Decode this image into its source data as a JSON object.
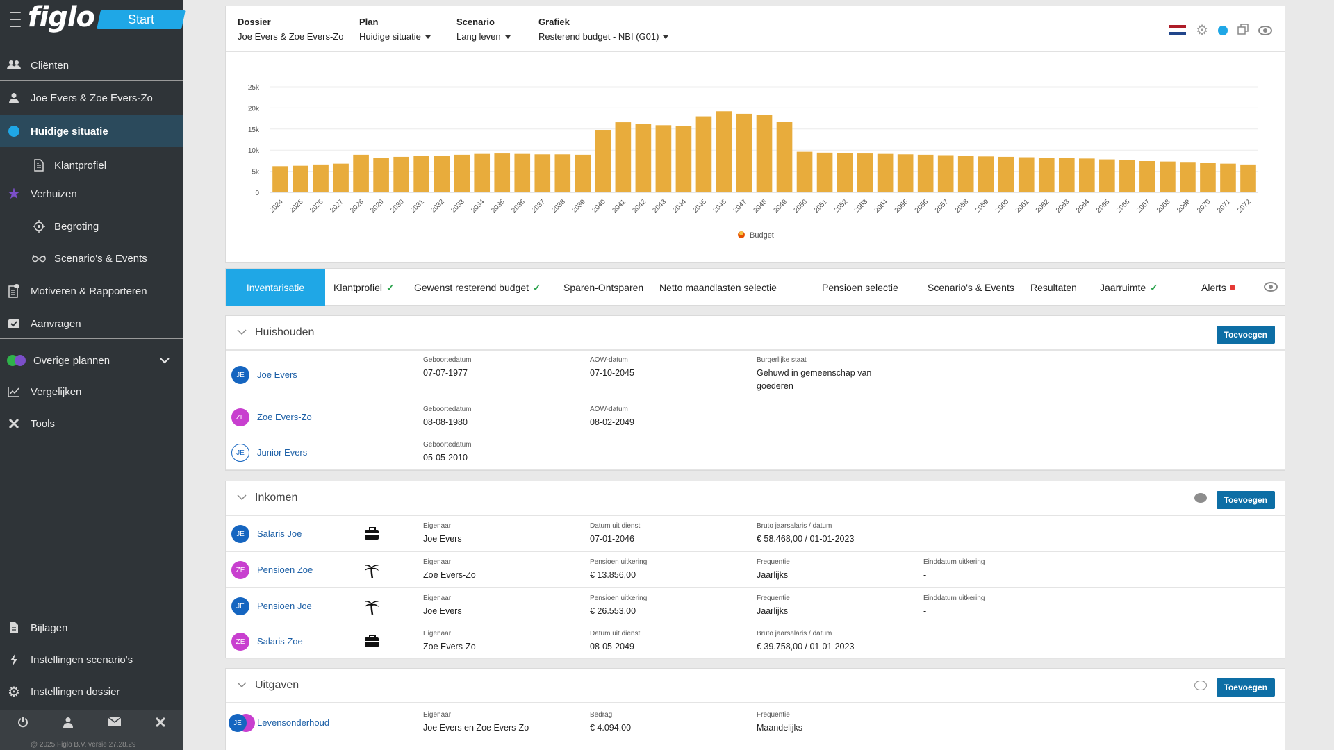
{
  "sidebar": {
    "logo": "figlo",
    "start_label": "Start",
    "items": [
      {
        "label": "Cliënten",
        "icon": "users-icon"
      },
      {
        "label": "Joe Evers & Zoe Evers-Zo",
        "icon": "user-icon"
      },
      {
        "label": "Huidige situatie",
        "icon": "blue-dot-icon"
      },
      {
        "label": "Klantprofiel",
        "icon": "document-icon"
      },
      {
        "label": "Verhuizen",
        "icon": "star-icon"
      },
      {
        "label": "Begroting",
        "icon": "crosshair-icon"
      },
      {
        "label": "Scenario's & Events",
        "icon": "glasses-icon"
      },
      {
        "label": "Motiveren & Rapporteren",
        "icon": "report-icon"
      },
      {
        "label": "Aanvragen",
        "icon": "request-icon"
      },
      {
        "label": "Overige plannen",
        "icon": "plans-icon"
      },
      {
        "label": "Vergelijken",
        "icon": "chart-line-icon"
      },
      {
        "label": "Tools",
        "icon": "tools-icon"
      },
      {
        "label": "Bijlagen",
        "icon": "attachment-icon"
      },
      {
        "label": "Instellingen scenario's",
        "icon": "bolt-icon"
      },
      {
        "label": "Instellingen dossier",
        "icon": "gear-icon"
      }
    ],
    "version": "@ 2025 Figlo B.V. versie 27.28.29"
  },
  "header": {
    "dossier_label": "Dossier",
    "dossier_value": "Joe Evers & Zoe Evers-Zo",
    "plan_label": "Plan",
    "plan_value": "Huidige situatie",
    "scenario_label": "Scenario",
    "scenario_value": "Lang leven",
    "grafiek_label": "Grafiek",
    "grafiek_value": "Resterend budget - NBI (G01)"
  },
  "colors": {
    "accent": "#1fa7e6",
    "bar": "#e8ac3c",
    "sidebar_bg": "#2f3438",
    "button": "#0d6ea5"
  },
  "chart_data": {
    "type": "bar",
    "categories": [
      "2024",
      "2025",
      "2026",
      "2027",
      "2028",
      "2029",
      "2030",
      "2031",
      "2032",
      "2033",
      "2034",
      "2035",
      "2036",
      "2037",
      "2038",
      "2039",
      "2040",
      "2041",
      "2042",
      "2043",
      "2044",
      "2045",
      "2046",
      "2047",
      "2048",
      "2049",
      "2050",
      "2051",
      "2052",
      "2053",
      "2054",
      "2055",
      "2056",
      "2057",
      "2058",
      "2059",
      "2060",
      "2061",
      "2062",
      "2063",
      "2064",
      "2065",
      "2066",
      "2067",
      "2068",
      "2069",
      "2070",
      "2071",
      "2072"
    ],
    "series": [
      {
        "name": "Budget",
        "values": [
          6200,
          6300,
          6600,
          6800,
          8900,
          8200,
          8400,
          8600,
          8700,
          8900,
          9100,
          9200,
          9100,
          9000,
          9000,
          8900,
          14800,
          16600,
          16200,
          15900,
          15700,
          18000,
          19200,
          18600,
          18400,
          16700,
          9600,
          9400,
          9300,
          9200,
          9100,
          9000,
          8900,
          8800,
          8600,
          8500,
          8400,
          8300,
          8200,
          8100,
          8000,
          7800,
          7600,
          7400,
          7300,
          7200,
          7000,
          6800,
          6600
        ]
      }
    ],
    "yticks": [
      "0",
      "5k",
      "10k",
      "15k",
      "20k",
      "25k"
    ],
    "ylim": [
      0,
      25000
    ],
    "legend": "bottom",
    "grid": true
  },
  "tabs": [
    {
      "label": "Inventarisatie",
      "check": false
    },
    {
      "label": "Klantprofiel",
      "check": true
    },
    {
      "label": "Gewenst resterend budget",
      "check": true
    },
    {
      "label": "Sparen-Ontsparen",
      "check": false
    },
    {
      "label": "Netto maandlasten selectie",
      "check": false
    },
    {
      "label": "Pensioen selectie",
      "check": false
    },
    {
      "label": "Scenario's & Events",
      "check": false
    },
    {
      "label": "Resultaten",
      "check": false
    },
    {
      "label": "Jaarruimte",
      "check": true
    },
    {
      "label": "Alerts",
      "check": false
    }
  ],
  "check_mark": "✓",
  "add_label": "Toevoegen",
  "huishouden": {
    "title": "Huishouden",
    "rows": [
      {
        "initials": "JE",
        "name": "Joe Evers",
        "c1_label": "Geboortedatum",
        "c1_value": "07-07-1977",
        "c2_label": "AOW-datum",
        "c2_value": "07-10-2045",
        "c3_label": "Burgerlijke staat",
        "c3_value": "Gehuwd in gemeenschap van goederen"
      },
      {
        "initials": "ZE",
        "name": "Zoe Evers-Zo",
        "c1_label": "Geboortedatum",
        "c1_value": "08-08-1980",
        "c2_label": "AOW-datum",
        "c2_value": "08-02-2049"
      },
      {
        "initials": "JE",
        "name": "Junior Evers",
        "c1_label": "Geboortedatum",
        "c1_value": "05-05-2010"
      }
    ]
  },
  "inkomen": {
    "title": "Inkomen",
    "rows": [
      {
        "initials": "JE",
        "name": "Salaris Joe",
        "icon": "briefcase-icon",
        "c1_label": "Eigenaar",
        "c1_value": "Joe Evers",
        "c2_label": "Datum uit dienst",
        "c2_value": "07-01-2046",
        "c3_label": "Bruto jaarsalaris / datum",
        "c3_value": "€ 58.468,00 / 01-01-2023"
      },
      {
        "initials": "ZE",
        "name": "Pensioen Zoe",
        "icon": "palm-tree-icon",
        "c1_label": "Eigenaar",
        "c1_value": "Zoe Evers-Zo",
        "c2_label": "Pensioen uitkering",
        "c2_value": "€ 13.856,00",
        "c3_label": "Frequentie",
        "c3_value": "Jaarlijks",
        "c4_label": "Einddatum uitkering",
        "c4_value": "-"
      },
      {
        "initials": "JE",
        "name": "Pensioen Joe",
        "icon": "palm-tree-icon",
        "c1_label": "Eigenaar",
        "c1_value": "Joe Evers",
        "c2_label": "Pensioen uitkering",
        "c2_value": "€ 26.553,00",
        "c3_label": "Frequentie",
        "c3_value": "Jaarlijks",
        "c4_label": "Einddatum uitkering",
        "c4_value": "-"
      },
      {
        "initials": "ZE",
        "name": "Salaris Zoe",
        "icon": "briefcase-icon",
        "c1_label": "Eigenaar",
        "c1_value": "Zoe Evers-Zo",
        "c2_label": "Datum uit dienst",
        "c2_value": "08-05-2049",
        "c3_label": "Bruto jaarsalaris / datum",
        "c3_value": "€ 39.758,00 / 01-01-2023"
      }
    ]
  },
  "uitgaven": {
    "title": "Uitgaven",
    "rows": [
      {
        "initials": "JE",
        "name": "Levensonderhoud",
        "c1_label": "Eigenaar",
        "c1_value": "Joe Evers en Zoe Evers-Zo",
        "c2_label": "Bedrag",
        "c2_value": "€ 4.094,00",
        "c3_label": "Frequentie",
        "c3_value": "Maandelijks"
      }
    ]
  }
}
